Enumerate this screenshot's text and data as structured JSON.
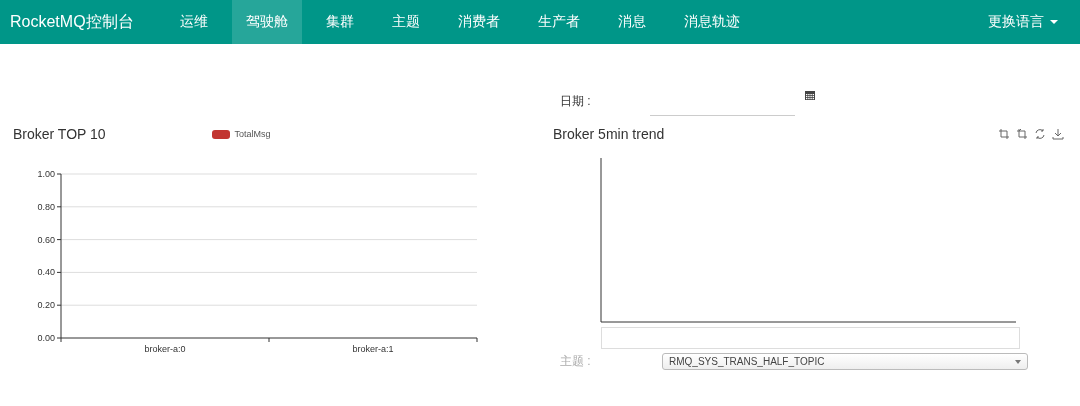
{
  "navbar": {
    "brand": "RocketMQ控制台",
    "items": [
      {
        "label": "运维",
        "selected": false
      },
      {
        "label": "驾驶舱",
        "selected": true
      },
      {
        "label": "集群",
        "selected": false
      },
      {
        "label": "主题",
        "selected": false
      },
      {
        "label": "消费者",
        "selected": false
      },
      {
        "label": "生产者",
        "selected": false
      },
      {
        "label": "消息",
        "selected": false
      },
      {
        "label": "消息轨迹",
        "selected": false
      }
    ],
    "language": "更换语言"
  },
  "date_filter": {
    "label": "日期 :"
  },
  "broker_top": {
    "title": "Broker TOP 10",
    "chart_data": {
      "type": "bar",
      "categories": [
        "broker-a:0",
        "broker-a:1"
      ],
      "series": [
        {
          "name": "TotalMsg",
          "color": "#c23531",
          "values": [
            0,
            0
          ]
        }
      ],
      "grid": true,
      "ylim": [
        0,
        1
      ],
      "yticks": [
        {
          "value": 0,
          "label": "0.00"
        },
        {
          "value": 0.2,
          "label": "0.20"
        },
        {
          "value": 0.4,
          "label": "0.40"
        },
        {
          "value": 0.6,
          "label": "0.60"
        },
        {
          "value": 0.8,
          "label": "0.80"
        },
        {
          "value": 1,
          "label": "1.00"
        }
      ]
    }
  },
  "broker_trend": {
    "title": "Broker 5min trend"
  },
  "topic_filter": {
    "label": "主题 :",
    "value": "RMQ_SYS_TRANS_HALF_TOPIC"
  }
}
